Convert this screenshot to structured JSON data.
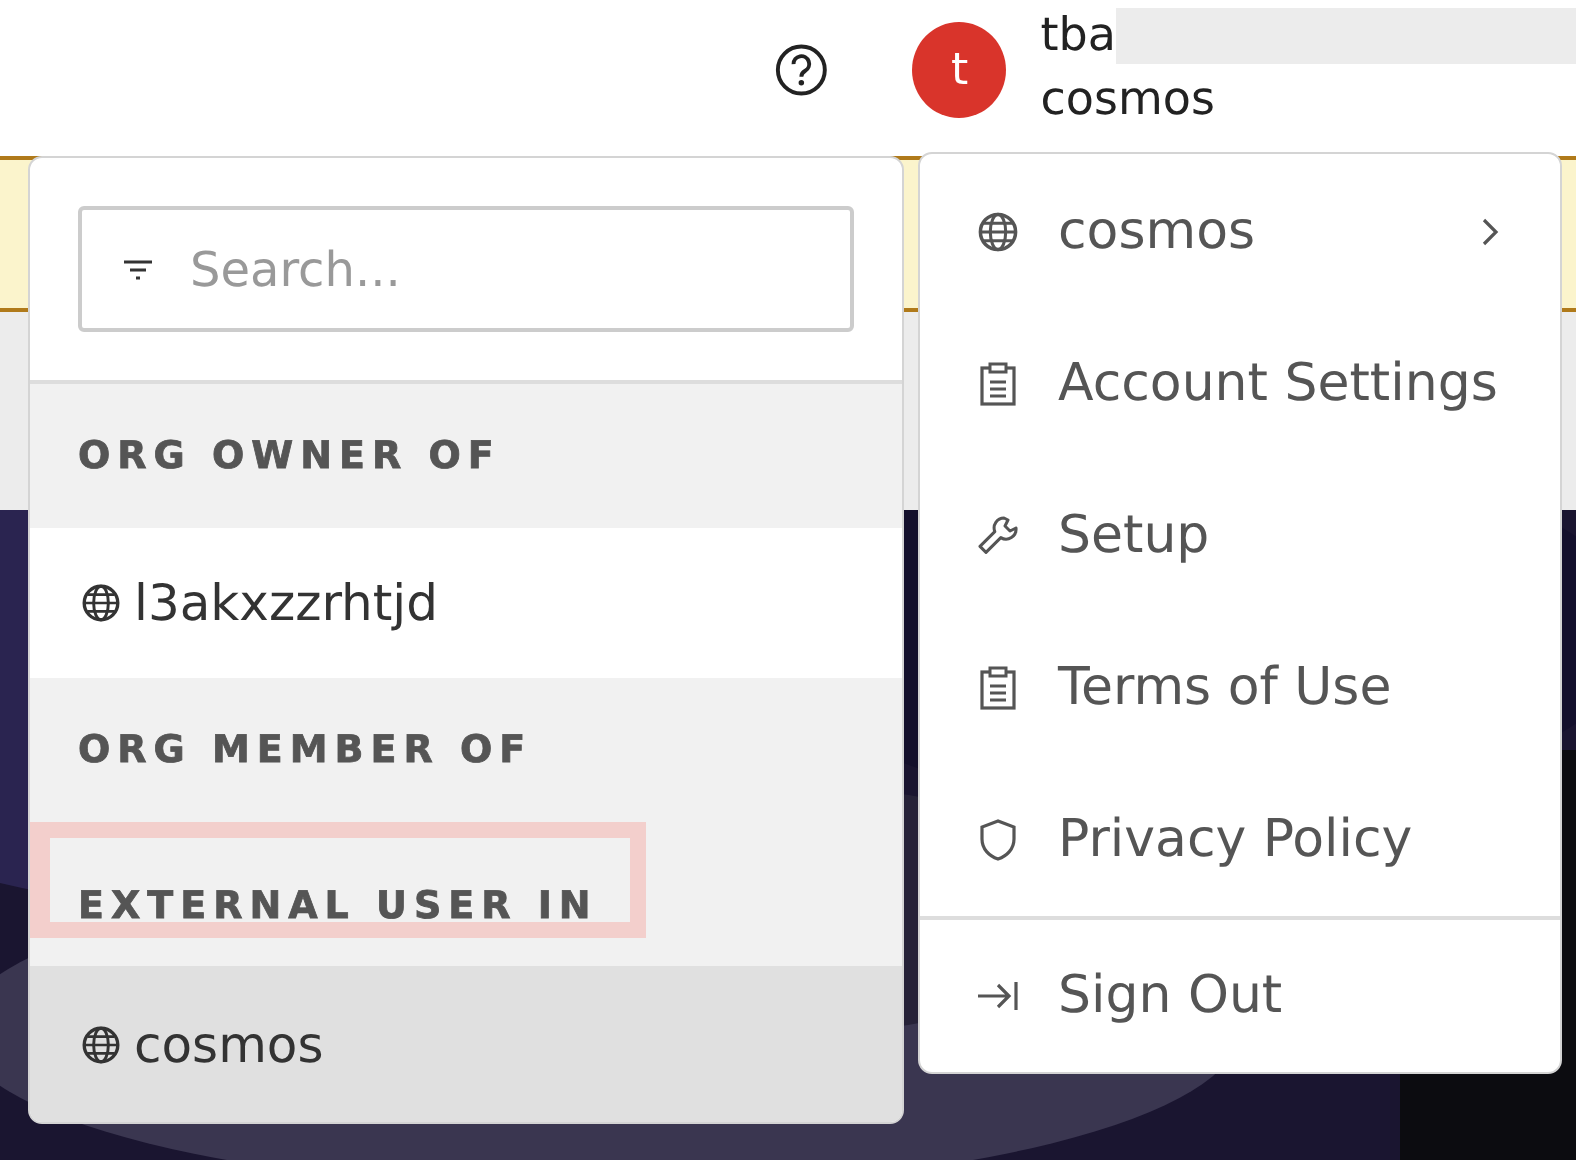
{
  "header": {
    "avatar_letter": "t",
    "user_name": "tba",
    "org_name": "cosmos"
  },
  "org_menu": {
    "search": {
      "placeholder": "Search..."
    },
    "sections": [
      {
        "heading": "ORG OWNER OF",
        "highlighted": false,
        "items": [
          {
            "label": "l3akxzzrhtjd",
            "selected": false
          }
        ]
      },
      {
        "heading": "ORG MEMBER OF",
        "highlighted": false
      },
      {
        "heading": "EXTERNAL USER IN",
        "highlighted": true,
        "items": [
          {
            "label": "cosmos",
            "selected": true
          }
        ]
      }
    ]
  },
  "account_menu": {
    "items": [
      {
        "label": "cosmos",
        "kind": "org",
        "submenu": true,
        "divider_before": false
      },
      {
        "label": "Account Settings",
        "kind": "document",
        "submenu": false,
        "divider_before": false
      },
      {
        "label": "Setup",
        "kind": "tool",
        "submenu": false,
        "divider_before": false
      },
      {
        "label": "Terms of Use",
        "kind": "document",
        "submenu": false,
        "divider_before": false
      },
      {
        "label": "Privacy Policy",
        "kind": "shield",
        "submenu": false,
        "divider_before": false
      },
      {
        "label": "Sign Out",
        "kind": "exit",
        "submenu": false,
        "divider_before": true
      }
    ]
  }
}
